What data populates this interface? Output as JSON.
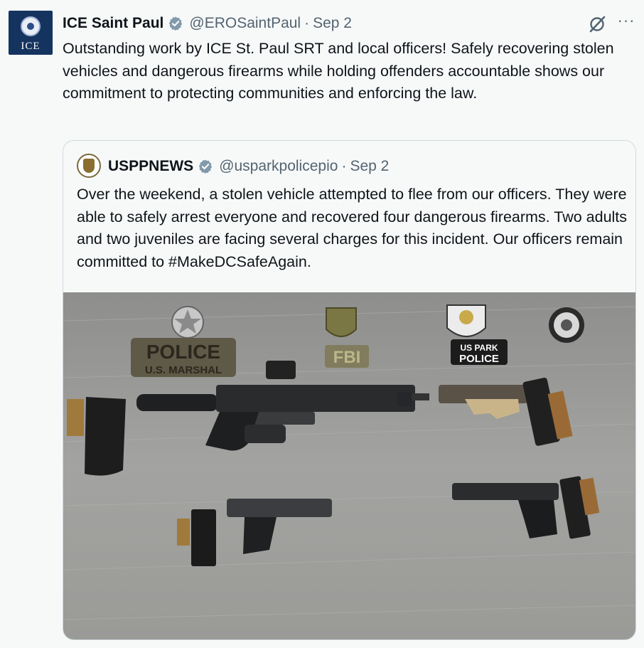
{
  "tweet": {
    "avatar_text": "ICE",
    "name": "ICE Saint Paul",
    "handle": "@EROSaintPaul",
    "separator": "·",
    "date": "Sep 2",
    "more_label": "···",
    "text": "Outstanding work by ICE St. Paul SRT and local officers! Safely recovering stolen vehicles and dangerous firearms while holding offenders accountable shows our commitment to protecting communities and enforcing the law."
  },
  "quote": {
    "name": "USPPNEWS",
    "handle": "@usparkpolicepio",
    "separator": "·",
    "date": "Sep 2",
    "text": "Over the weekend, a stolen vehicle attempted to flee from our officers. They were able to safely arrest everyone and recovered four dangerous firearms. Two adults and two juveniles are facing several charges for this incident. Our officers remain committed to #MakeDCSafeAgain.",
    "photo": {
      "patch_police_line1": "POLICE",
      "patch_police_line2": "U.S. MARSHAL",
      "patch_fbi": "FBI",
      "patch_park_line1": "US PARK",
      "patch_park_line2": "POLICE"
    }
  },
  "colors": {
    "verified": "#829aab",
    "secondary_text": "#536471",
    "border": "#cfd9de",
    "ice_navy": "#15335f"
  },
  "icons": [
    "verified-badge-icon",
    "grok-icon",
    "more-icon"
  ]
}
